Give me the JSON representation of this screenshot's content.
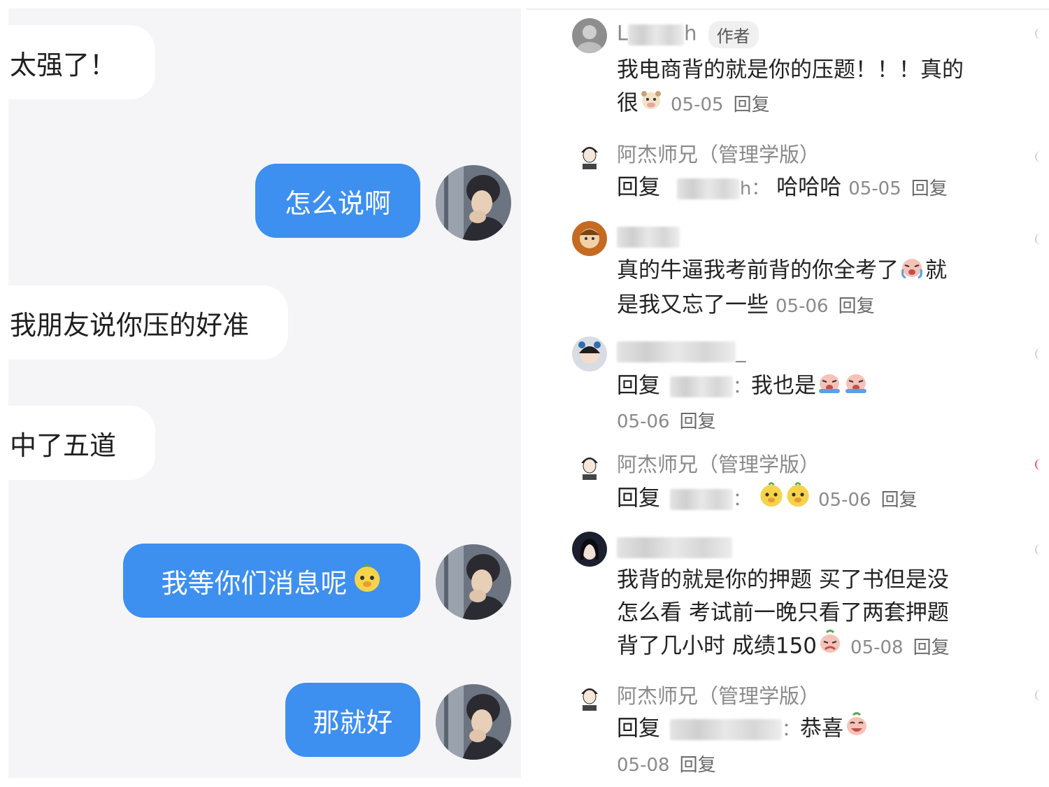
{
  "chat": {
    "messages": [
      {
        "side": "in",
        "text": "太强了！"
      },
      {
        "side": "out",
        "text": "怎么说啊"
      },
      {
        "side": "in",
        "text": "我朋友说你压的好准"
      },
      {
        "side": "in",
        "text": "中了五道"
      },
      {
        "side": "out",
        "text": "我等你们消息呢",
        "emoji": "chick-face-icon"
      },
      {
        "side": "out",
        "text": "那就好"
      }
    ]
  },
  "comments": [
    {
      "name": "L",
      "name_tail": "h",
      "badge": "作者",
      "text_lines": [
        "我电商背的就是你的压题！！！真的",
        "很"
      ],
      "emoji": "cow-face-icon",
      "date": "05-05",
      "reply": "回复"
    },
    {
      "name": "阿杰师兄（管理学版）",
      "prefix": "回复",
      "target_tail": "h：",
      "text": "哈哈哈",
      "date": "05-05",
      "reply": "回复"
    },
    {
      "name": "",
      "text_lines": [
        "真的牛逼我考前背的你全考了",
        "是我又忘了一些"
      ],
      "inline_after": "就",
      "emoji": "crying-face-icon",
      "date": "05-06",
      "reply": "回复"
    },
    {
      "name": "",
      "name_tail": "_",
      "prefix": "回复",
      "target_tail": "：",
      "text": "我也是",
      "emoji": "crying-face-icon",
      "date": "05-06",
      "reply": "回复"
    },
    {
      "name": "阿杰师兄（管理学版）",
      "prefix": "回复",
      "target_tail": "：",
      "text": "",
      "emoji": "chick-face-icon",
      "date": "05-06",
      "reply": "回复"
    },
    {
      "name": "",
      "text_lines": [
        "我背的就是你的押题 买了书但是没",
        "怎么看 考试前一晚只看了两套押题",
        "背了几小时 成绩150"
      ],
      "emoji": "sad-face-icon",
      "date": "05-08",
      "reply": "回复"
    },
    {
      "name": "阿杰师兄（管理学版）",
      "prefix": "回复",
      "target_tail": "：",
      "text": "恭喜",
      "emoji": "laughing-face-icon",
      "date": "05-08",
      "reply": "回复"
    }
  ],
  "colors": {
    "outgoing_bubble": "#3d8ff0",
    "incoming_bubble": "#ffffff",
    "chat_bg": "#f5f5f7",
    "meta_gray": "#8a8a8a"
  }
}
